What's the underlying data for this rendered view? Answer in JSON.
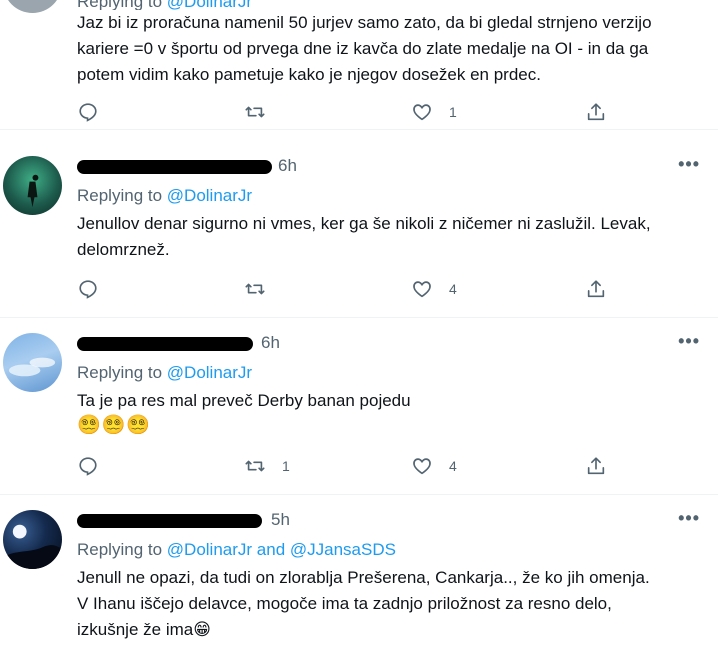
{
  "tweets": [
    {
      "time": "",
      "replying_prefix": "Replying to ",
      "mention1": "@DolinarJr",
      "text_lines": [
        "Jaz bi iz proračuna namenil 50 jurjev samo zato, da bi gledal strnjeno verzijo",
        "kariere =0 v športu od prvega dne iz kavča do zlate medalje na OI - in da ga",
        "potem vidim kako pametuje kako je njegov dosežek en prdec."
      ],
      "replies": "",
      "retweets": "",
      "likes": "1"
    },
    {
      "time": "6h",
      "replying_prefix": "Replying to ",
      "mention1": "@DolinarJr",
      "text_lines": [
        "Jenullov denar sigurno ni vmes, ker ga še nikoli z ničemer ni zaslužil. Levak,",
        "delomrznež."
      ],
      "replies": "",
      "retweets": "",
      "likes": "4"
    },
    {
      "time": "6h",
      "replying_prefix": "Replying to ",
      "mention1": "@DolinarJr",
      "text_lines": [
        "Ta je pa res mal preveč Derby banan pojedu"
      ],
      "emoji": "😵‍💫😵‍💫😵‍💫",
      "replies": "",
      "retweets": "1",
      "likes": "4"
    },
    {
      "time": "5h",
      "replying_prefix": "Replying to ",
      "mention1": "@DolinarJr",
      "and": " and ",
      "mention2": "@JJansaSDS",
      "text_lines": [
        "Jenull ne opazi, da tudi on zlorablja Prešerena, Cankarja.., že ko jih omenja.",
        "V Ihanu iščejo delavce, mogoče ima ta zadnjo priložnost za resno delo,",
        "izkušnje že ima😁"
      ]
    }
  ],
  "more_label": "•••",
  "colors": {
    "accent": "#1d9bf0",
    "secondary": "#536471"
  }
}
